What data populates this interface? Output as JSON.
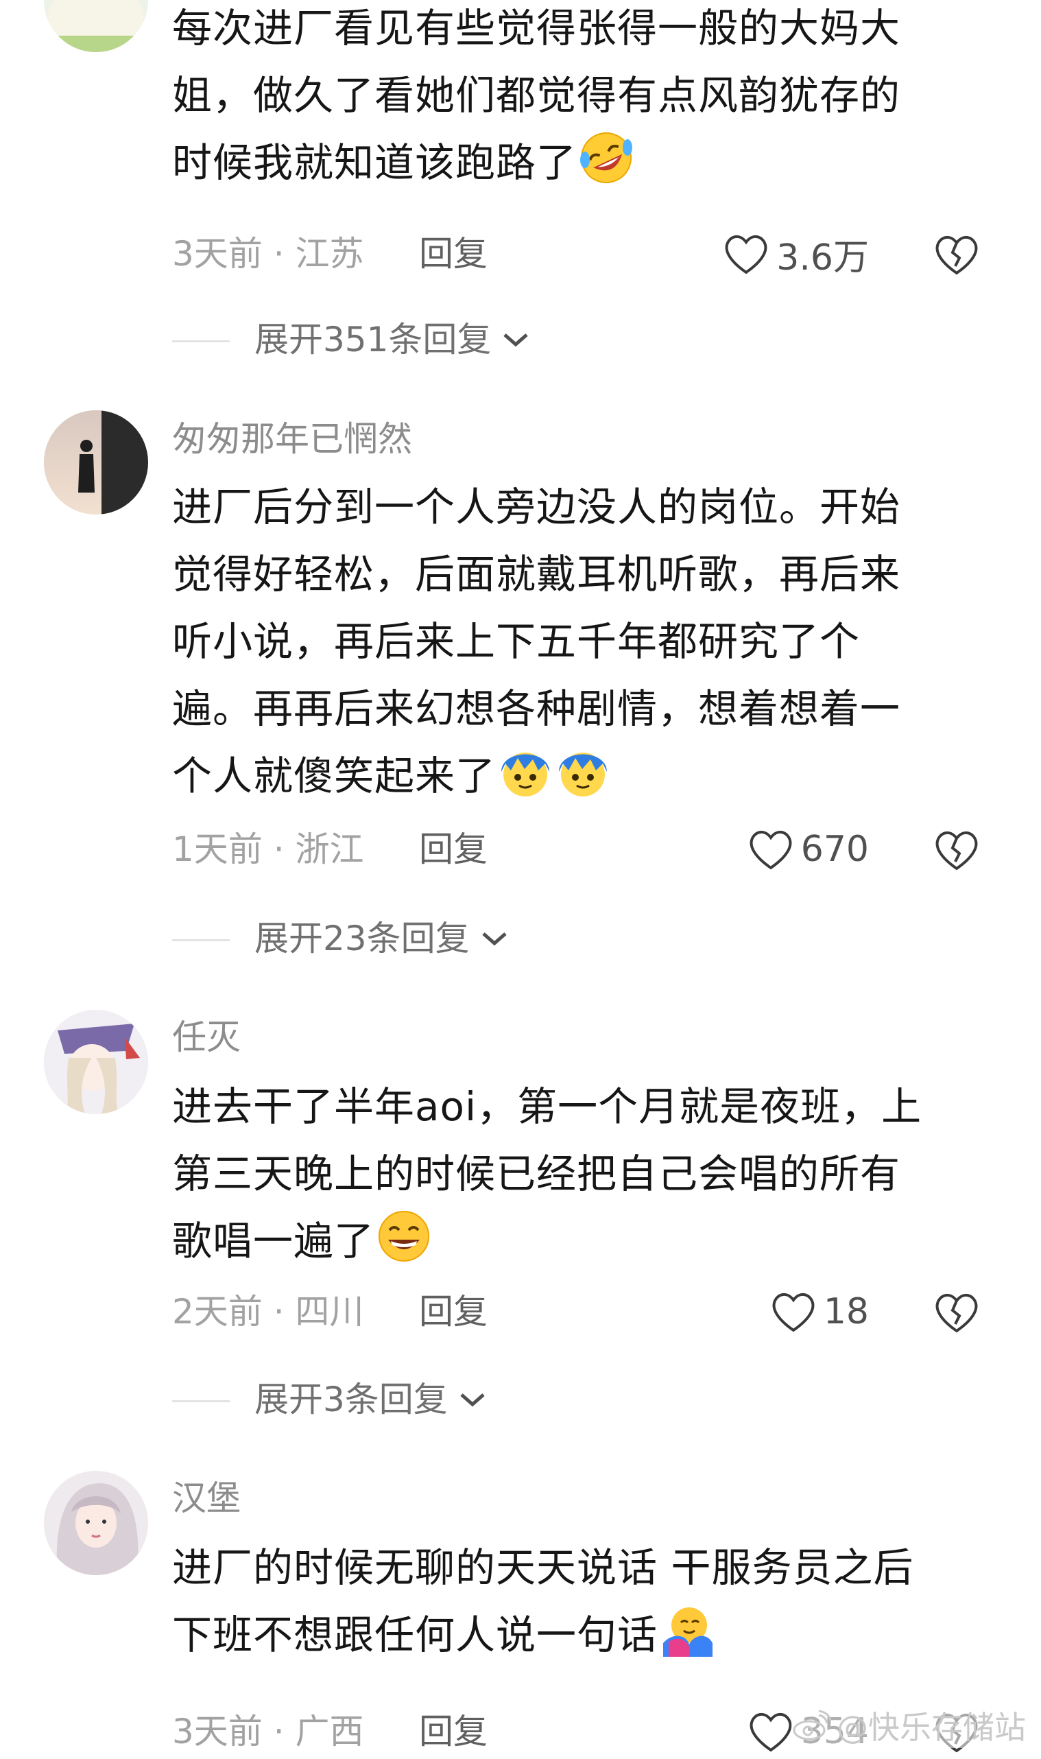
{
  "comments": [
    {
      "username": "",
      "text_lines": [
        "每次进厂看见有些觉得张得一般的大妈大",
        "姐，做久了看她们都觉得有点风韵犹存的",
        "时候我就知道该跑路了"
      ],
      "emoji": "rofl-emoji",
      "time_location": "3天前 · 江苏",
      "reply_label": "回复",
      "likes": "3.6万",
      "expand_label": "展开351条回复"
    },
    {
      "username": "匆匆那年已惘然",
      "text_lines": [
        "进厂后分到一个人旁边没人的岗位。开始",
        "觉得好轻松，后面就戴耳机听歌，再后来",
        "听小说，再后来上下五千年都研究了个",
        "遍。再再后来幻想各种剧情，想着想着一",
        "个人就傻笑起来了"
      ],
      "emoji": "blue-hair-face-emoji",
      "time_location": "1天前 · 浙江",
      "reply_label": "回复",
      "likes": "670",
      "expand_label": "展开23条回复"
    },
    {
      "username": "任灭",
      "text_lines": [
        "进去干了半年aoi，第一个月就是夜班，上",
        "第三天晚上的时候已经把自己会唱的所有",
        "歌唱一遍了"
      ],
      "emoji": "grin-emoji",
      "time_location": "2天前 · 四川",
      "reply_label": "回复",
      "likes": "18",
      "expand_label": "展开3条回复"
    },
    {
      "username": "汉堡",
      "text_lines": [
        "进厂的时候无聊的天天说话 干服务员之后",
        "下班不想跟任何人说一句话"
      ],
      "emoji": "hug-emoji",
      "time_location": "3天前 · 广西",
      "reply_label": "回复",
      "likes": "354",
      "expand_label": ""
    }
  ],
  "watermark": "@快乐存储站",
  "colors": {
    "text": "#161616",
    "meta": "#a2a2a2",
    "username": "#8c8c8c",
    "icon": "#3a3a3a"
  }
}
